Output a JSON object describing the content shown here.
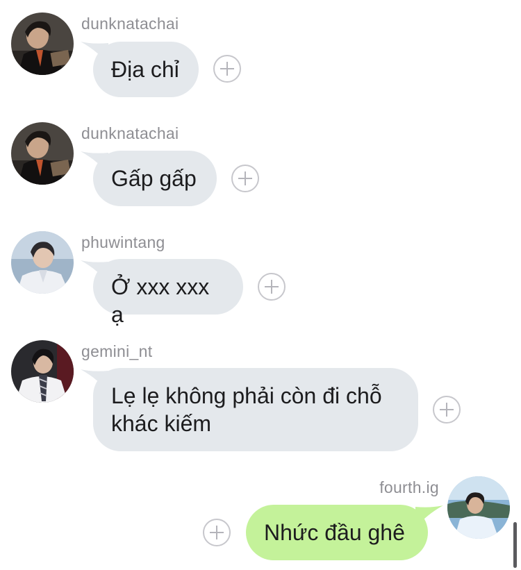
{
  "messages": [
    {
      "username": "dunknatachai",
      "text": "Địa chỉ",
      "direction": "incoming"
    },
    {
      "username": "dunknatachai",
      "text": "Gấp gấp",
      "direction": "incoming"
    },
    {
      "username": "phuwintang",
      "text": "Ở xxx xxx ạ",
      "direction": "incoming"
    },
    {
      "username": "gemini_nt",
      "text": "Lẹ lẹ không phải còn đi chỗ khác kiếm",
      "direction": "incoming"
    },
    {
      "username": "fourth.ig",
      "text": "Nhức đầu ghê",
      "direction": "outgoing"
    }
  ],
  "icons": {
    "reaction": "add-reaction-icon"
  },
  "colors": {
    "incoming_bubble": "#e4e8ec",
    "outgoing_bubble": "#c4f29a",
    "username": "#8e8e93"
  }
}
